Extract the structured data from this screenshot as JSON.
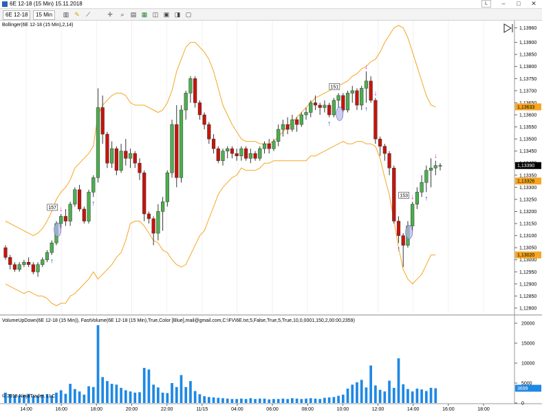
{
  "window": {
    "title": "6E 12-18 (15 Min)  15.11.2018",
    "minimize": "–",
    "maximize": "□",
    "close": "✕",
    "lock": "L"
  },
  "toolbar": {
    "instrument": "6E 12-18",
    "interval": "15 Min",
    "icons": [
      "bar-chart-icon",
      "pencil-icon",
      "drawing-tools-icon",
      "crosshair-icon",
      "zoom-icon",
      "properties-icon",
      "strategy-icon",
      "indicator-icon",
      "chart-trader-icon",
      "data-box-icon",
      "window-icon"
    ]
  },
  "price_panel": {
    "indicator_label": "Bollinger(6E 12-18 (15 Min),2,14)",
    "y_ticks": [
      "1,13960",
      "1,13900",
      "1,13850",
      "1,13800",
      "1,13750",
      "1,13700",
      "1,13650",
      "1,13600",
      "1,13550",
      "1,13500",
      "1,13450",
      "1,13400",
      "1,13350",
      "1,13300",
      "1,13250",
      "1,13200",
      "1,13150",
      "1,13100",
      "1,13050",
      "1,13000",
      "1,12950",
      "1,12900",
      "1,12850",
      "1,12800"
    ],
    "upper_band_value": "1,13633",
    "last_price": "1,13390",
    "mid_band_value": "1,13326",
    "lower_band_value": "1,13020",
    "markers": [
      "157",
      "151",
      "153"
    ]
  },
  "volume_panel": {
    "indicator_label": "VolumeUpDown(6E 12-18 (15 Min)), FastVolume(6E 12-18 (15 Min),True,Color [Blue],mail@gmail.com,C:\\FV\\6E.txt,5,False,True,5,True,10,0,0001,150,2,00:00,2359)",
    "y_ticks": [
      "20000",
      "15000",
      "10000",
      "5000",
      "0"
    ],
    "last_volume": "3699",
    "copyright": "© 2018 NinjaTrader, LLC"
  },
  "x_axis": {
    "ticks": [
      "14:00",
      "16:00",
      "18:00",
      "20:00",
      "22:00",
      "11/15",
      "04:00",
      "06:00",
      "08:00",
      "10:00",
      "12:00",
      "14:00",
      "16:00",
      "18:00"
    ]
  },
  "colors": {
    "bull": "#4caf50",
    "bear": "#c8140a",
    "band": "#f5a623",
    "volume": "#1e88e5",
    "up_arrow": "#1a3fd6",
    "down_arrow": "#e020c0"
  },
  "chart_data": {
    "type": "candlestick",
    "candles": [
      [
        1.1305,
        1.1306,
        1.13,
        1.1301
      ],
      [
        1.1301,
        1.1302,
        1.1296,
        1.1298
      ],
      [
        1.1298,
        1.1299,
        1.1295,
        1.1296
      ],
      [
        1.1296,
        1.1299,
        1.1295,
        1.1298
      ],
      [
        1.1298,
        1.13,
        1.1297,
        1.1299
      ],
      [
        1.1299,
        1.1301,
        1.1297,
        1.1298
      ],
      [
        1.1298,
        1.1299,
        1.1294,
        1.1295
      ],
      [
        1.1295,
        1.1299,
        1.1293,
        1.1298
      ],
      [
        1.1298,
        1.1301,
        1.1297,
        1.13
      ],
      [
        1.13,
        1.1304,
        1.1299,
        1.1303
      ],
      [
        1.1303,
        1.1308,
        1.1302,
        1.1307
      ],
      [
        1.1307,
        1.1316,
        1.1306,
        1.1315
      ],
      [
        1.1315,
        1.1319,
        1.1313,
        1.1318
      ],
      [
        1.1318,
        1.1321,
        1.1314,
        1.1316
      ],
      [
        1.1316,
        1.1324,
        1.1314,
        1.1323
      ],
      [
        1.1323,
        1.133,
        1.1322,
        1.1329
      ],
      [
        1.1329,
        1.1331,
        1.132,
        1.1321
      ],
      [
        1.1321,
        1.1322,
        1.1315,
        1.1316
      ],
      [
        1.1316,
        1.1329,
        1.1315,
        1.1328
      ],
      [
        1.1328,
        1.1335,
        1.1326,
        1.1334
      ],
      [
        1.1334,
        1.1371,
        1.1332,
        1.1363
      ],
      [
        1.1363,
        1.1368,
        1.1348,
        1.1352
      ],
      [
        1.1352,
        1.1353,
        1.1338,
        1.134
      ],
      [
        1.134,
        1.1349,
        1.1338,
        1.1346
      ],
      [
        1.1346,
        1.1347,
        1.1335,
        1.1337
      ],
      [
        1.1337,
        1.1348,
        1.1336,
        1.1345
      ],
      [
        1.1345,
        1.135,
        1.1339,
        1.1342
      ],
      [
        1.1342,
        1.1346,
        1.1338,
        1.1344
      ],
      [
        1.1344,
        1.1345,
        1.1338,
        1.134
      ],
      [
        1.134,
        1.1342,
        1.1333,
        1.1336
      ],
      [
        1.1336,
        1.1337,
        1.1316,
        1.1319
      ],
      [
        1.1319,
        1.132,
        1.1315,
        1.1317
      ],
      [
        1.1317,
        1.1318,
        1.1306,
        1.1311
      ],
      [
        1.1311,
        1.1323,
        1.1308,
        1.132
      ],
      [
        1.132,
        1.1326,
        1.1312,
        1.1324
      ],
      [
        1.1324,
        1.1337,
        1.1322,
        1.1336
      ],
      [
        1.1336,
        1.1358,
        1.1334,
        1.1356
      ],
      [
        1.1356,
        1.1364,
        1.133,
        1.1334
      ],
      [
        1.1334,
        1.1364,
        1.1332,
        1.1362
      ],
      [
        1.1362,
        1.137,
        1.1358,
        1.1369
      ],
      [
        1.1369,
        1.1376,
        1.1365,
        1.1375
      ],
      [
        1.1375,
        1.1376,
        1.1363,
        1.1365
      ],
      [
        1.1365,
        1.1366,
        1.1358,
        1.136
      ],
      [
        1.136,
        1.1361,
        1.1354,
        1.1356
      ],
      [
        1.1356,
        1.1357,
        1.1348,
        1.135
      ],
      [
        1.135,
        1.1352,
        1.1344,
        1.1346
      ],
      [
        1.1346,
        1.1347,
        1.134,
        1.1341
      ],
      [
        1.1341,
        1.1346,
        1.1339,
        1.1345
      ],
      [
        1.1345,
        1.1347,
        1.1342,
        1.1346
      ],
      [
        1.1346,
        1.1347,
        1.1342,
        1.1344
      ],
      [
        1.1344,
        1.1346,
        1.1341,
        1.1343
      ],
      [
        1.1343,
        1.1347,
        1.1341,
        1.1346
      ],
      [
        1.1346,
        1.1347,
        1.1341,
        1.1342
      ],
      [
        1.1342,
        1.1346,
        1.134,
        1.1344
      ],
      [
        1.1344,
        1.1345,
        1.1341,
        1.1342
      ],
      [
        1.1342,
        1.1347,
        1.1341,
        1.1346
      ],
      [
        1.1346,
        1.1349,
        1.1344,
        1.1348
      ],
      [
        1.1348,
        1.135,
        1.1344,
        1.1346
      ],
      [
        1.1346,
        1.135,
        1.1345,
        1.1349
      ],
      [
        1.1349,
        1.1356,
        1.1347,
        1.1354
      ],
      [
        1.1354,
        1.1358,
        1.1351,
        1.1356
      ],
      [
        1.1356,
        1.1359,
        1.1352,
        1.1354
      ],
      [
        1.1354,
        1.136,
        1.1353,
        1.1358
      ],
      [
        1.1358,
        1.1359,
        1.1353,
        1.1356
      ],
      [
        1.1356,
        1.1361,
        1.1355,
        1.136
      ],
      [
        1.136,
        1.1363,
        1.1358,
        1.1361
      ],
      [
        1.1361,
        1.1366,
        1.1359,
        1.1365
      ],
      [
        1.1365,
        1.1368,
        1.1362,
        1.1364
      ],
      [
        1.1364,
        1.1365,
        1.136,
        1.1363
      ],
      [
        1.1363,
        1.1366,
        1.1361,
        1.1364
      ],
      [
        1.1364,
        1.1365,
        1.1359,
        1.136
      ],
      [
        1.136,
        1.1367,
        1.1359,
        1.1366
      ],
      [
        1.1366,
        1.1369,
        1.1363,
        1.1368
      ],
      [
        1.1368,
        1.1369,
        1.1361,
        1.1362
      ],
      [
        1.1362,
        1.137,
        1.1361,
        1.1369
      ],
      [
        1.1369,
        1.1372,
        1.1365,
        1.137
      ],
      [
        1.137,
        1.1371,
        1.1362,
        1.1364
      ],
      [
        1.1364,
        1.1372,
        1.1362,
        1.1371
      ],
      [
        1.1371,
        1.1378,
        1.1365,
        1.1374
      ],
      [
        1.1374,
        1.1376,
        1.1365,
        1.1366
      ],
      [
        1.1366,
        1.1367,
        1.1348,
        1.135
      ],
      [
        1.135,
        1.1351,
        1.1343,
        1.1347
      ],
      [
        1.1347,
        1.1348,
        1.1341,
        1.1344
      ],
      [
        1.1344,
        1.1345,
        1.1335,
        1.1338
      ],
      [
        1.1338,
        1.1339,
        1.1315,
        1.1316
      ],
      [
        1.1316,
        1.1318,
        1.1307,
        1.131
      ],
      [
        1.131,
        1.1311,
        1.1297,
        1.1306
      ],
      [
        1.1306,
        1.1316,
        1.1305,
        1.1314
      ],
      [
        1.1314,
        1.1324,
        1.1312,
        1.1323
      ],
      [
        1.1323,
        1.133,
        1.1321,
        1.1328
      ],
      [
        1.1328,
        1.1335,
        1.1326,
        1.1332
      ],
      [
        1.1332,
        1.1339,
        1.1328,
        1.1337
      ],
      [
        1.1337,
        1.1342,
        1.133,
        1.1338
      ],
      [
        1.1338,
        1.1341,
        1.1335,
        1.1339
      ],
      [
        1.1339,
        1.134,
        1.1337,
        1.1339
      ]
    ],
    "volumes": [
      2600,
      2200,
      2000,
      1900,
      2000,
      2300,
      1800,
      1700,
      2100,
      2200,
      1900,
      2600,
      3200,
      2300,
      4800,
      3500,
      2900,
      2100,
      4200,
      4000,
      19500,
      6500,
      5500,
      4800,
      4600,
      3800,
      3200,
      2900,
      2600,
      2700,
      8800,
      8400,
      4600,
      3900,
      2600,
      2500,
      5000,
      4000,
      7000,
      4000,
      5500,
      3000,
      2200,
      1700,
      1500,
      1400,
      1300,
      1200,
      1100,
      1000,
      1000,
      1100,
      1000,
      1200,
      1000,
      1100,
      1100,
      900,
      1000,
      1000,
      1100,
      1000,
      1200,
      1100,
      1000,
      1100,
      1200,
      1100,
      1000,
      1300,
      1400,
      1500,
      1800,
      2100,
      3600,
      4600,
      5200,
      5800,
      3900,
      9400,
      4400,
      3300,
      2900,
      5600,
      3800,
      11200,
      4700,
      3500,
      2900,
      3600,
      3400,
      3000,
      3800,
      3699
    ],
    "bb_upper": [
      1.1316,
      1.1315,
      1.1314,
      1.1313,
      1.1312,
      1.1311,
      1.131,
      1.1311,
      1.1313,
      1.1316,
      1.132,
      1.1325,
      1.1328,
      1.133,
      1.1333,
      1.1338,
      1.134,
      1.1342,
      1.1344,
      1.1347,
      1.136,
      1.1364,
      1.1366,
      1.1368,
      1.1369,
      1.1369,
      1.1368,
      1.1365,
      1.1364,
      1.1364,
      1.1364,
      1.1363,
      1.1362,
      1.1361,
      1.1362,
      1.1365,
      1.137,
      1.1378,
      1.1383,
      1.1388,
      1.139,
      1.139,
      1.1388,
      1.1386,
      1.1383,
      1.1378,
      1.1371,
      1.1364,
      1.136,
      1.1356,
      1.1353,
      1.135,
      1.1349,
      1.1349,
      1.1349,
      1.1348,
      1.1348,
      1.1348,
      1.1349,
      1.1351,
      1.1353,
      1.1355,
      1.1357,
      1.1359,
      1.1361,
      1.1363,
      1.1365,
      1.1367,
      1.1368,
      1.1369,
      1.137,
      1.1371,
      1.1372,
      1.1373,
      1.1374,
      1.1376,
      1.1377,
      1.1379,
      1.138,
      1.1382,
      1.1383,
      1.1386,
      1.139,
      1.1393,
      1.1396,
      1.1397,
      1.1396,
      1.1392,
      1.1386,
      1.138,
      1.1374,
      1.1368,
      1.1364,
      1.13633
    ],
    "bb_mid": [
      1.1303,
      1.1302,
      1.1301,
      1.13,
      1.1299,
      1.1299,
      1.1298,
      1.1298,
      1.1299,
      1.13,
      1.1301,
      1.1303,
      1.1305,
      1.1306,
      1.1309,
      1.1312,
      1.1314,
      1.1316,
      1.1318,
      1.1321,
      1.1326,
      1.1329,
      1.1331,
      1.1333,
      1.1335,
      1.1336,
      1.1338,
      1.134,
      1.134,
      1.134,
      1.1339,
      1.1337,
      1.1335,
      1.1334,
      1.1333,
      1.1334,
      1.1335,
      1.1338,
      1.134,
      1.1343,
      1.1346,
      1.1348,
      1.1349,
      1.1349,
      1.135,
      1.135,
      1.1349,
      1.1347,
      1.1346,
      1.1345,
      1.1344,
      1.1344,
      1.1343,
      1.1343,
      1.1343,
      1.1343,
      1.1344,
      1.1344,
      1.1345,
      1.1346,
      1.1347,
      1.1348,
      1.1349,
      1.135,
      1.1351,
      1.1352,
      1.1354,
      1.1355,
      1.1356,
      1.1357,
      1.1358,
      1.1359,
      1.136,
      1.1361,
      1.1361,
      1.1362,
      1.1363,
      1.1364,
      1.1364,
      1.1365,
      1.1365,
      1.1364,
      1.1362,
      1.136,
      1.1356,
      1.1351,
      1.1346,
      1.1342,
      1.1338,
      1.1336,
      1.1334,
      1.1333,
      1.1333,
      1.13326
    ],
    "bb_lower": [
      1.129,
      1.1289,
      1.1288,
      1.1287,
      1.1286,
      1.1287,
      1.1286,
      1.1285,
      1.1285,
      1.1284,
      1.1282,
      1.1281,
      1.1282,
      1.1282,
      1.1285,
      1.1286,
      1.1288,
      1.129,
      1.1292,
      1.1295,
      1.1292,
      1.1294,
      1.1296,
      1.1298,
      1.1301,
      1.1303,
      1.1308,
      1.1315,
      1.1316,
      1.1316,
      1.1314,
      1.1311,
      1.1308,
      1.1307,
      1.1304,
      1.1303,
      1.13,
      1.1298,
      1.1297,
      1.1298,
      1.1302,
      1.1306,
      1.131,
      1.1312,
      1.1317,
      1.1322,
      1.1327,
      1.133,
      1.1332,
      1.1334,
      1.1335,
      1.1338,
      1.1337,
      1.1337,
      1.1337,
      1.1338,
      1.134,
      1.134,
      1.1341,
      1.1341,
      1.1341,
      1.1341,
      1.1341,
      1.1341,
      1.1341,
      1.1341,
      1.1343,
      1.1343,
      1.1344,
      1.1345,
      1.1346,
      1.1347,
      1.1348,
      1.1349,
      1.1348,
      1.1348,
      1.1349,
      1.1349,
      1.1348,
      1.1348,
      1.1347,
      1.1342,
      1.1334,
      1.1327,
      1.1316,
      1.1305,
      1.1296,
      1.1292,
      1.129,
      1.1292,
      1.1294,
      1.1298,
      1.1302,
      1.1302
    ],
    "up_arrows": [
      10,
      19,
      70,
      78,
      85,
      91
    ],
    "down_arrows": [
      12,
      78,
      80,
      88,
      93
    ],
    "ylim": [
      1.1278,
      1.1399
    ],
    "volume_ylim": [
      0,
      20000
    ]
  }
}
